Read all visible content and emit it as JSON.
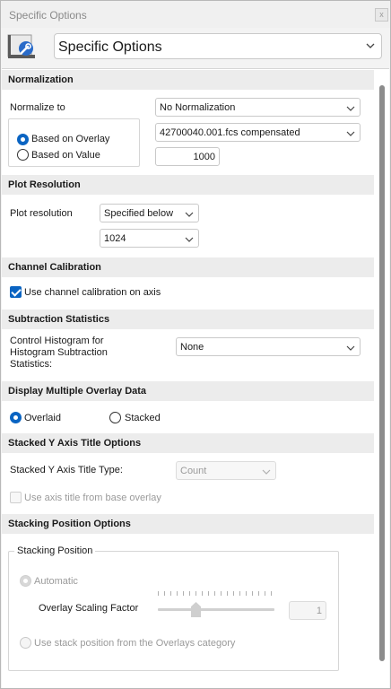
{
  "window": {
    "title": "Specific Options",
    "close_label": "x"
  },
  "header": {
    "selected": "Specific Options"
  },
  "normalization": {
    "title": "Normalization",
    "normalize_to_label": "Normalize to",
    "normalize_to_value": "No Normalization",
    "based_on_overlay_label": "Based on Overlay",
    "overlay_value": "42700040.001.fcs compensated",
    "based_on_value_label": "Based on Value",
    "value": "1000",
    "selected_mode": "overlay"
  },
  "plot_resolution": {
    "title": "Plot Resolution",
    "label": "Plot resolution",
    "mode_value": "Specified below",
    "resolution_value": "1024"
  },
  "channel_calibration": {
    "title": "Channel Calibration",
    "checkbox_label": "Use channel calibration on axis",
    "checked": true
  },
  "subtraction_statistics": {
    "title": "Subtraction Statistics",
    "label_line1": "Control Histogram for",
    "label_line2": "Histogram Subtraction",
    "label_line3": "Statistics:",
    "value": "None"
  },
  "display_overlay": {
    "title": "Display Multiple Overlay Data",
    "overlaid_label": "Overlaid",
    "stacked_label": "Stacked",
    "selected": "overlaid"
  },
  "stacked_y_axis": {
    "title": "Stacked Y Axis Title Options",
    "type_label": "Stacked Y Axis Title Type:",
    "type_value": "Count",
    "base_overlay_label": "Use axis title from base overlay"
  },
  "stacking_position": {
    "title": "Stacking Position Options",
    "group_label": "Stacking Position",
    "automatic_label": "Automatic",
    "scaling_label": "Overlay Scaling Factor",
    "scaling_value": "1",
    "stack_overlays_label": "Use stack position from the Overlays category"
  },
  "colors": {
    "accent": "#0a64c2",
    "section_bg": "#ececec",
    "scrollbar": "#8c8c8c"
  },
  "icons": {
    "header": "wrench-icon",
    "chevron": "chevron-down-icon"
  }
}
